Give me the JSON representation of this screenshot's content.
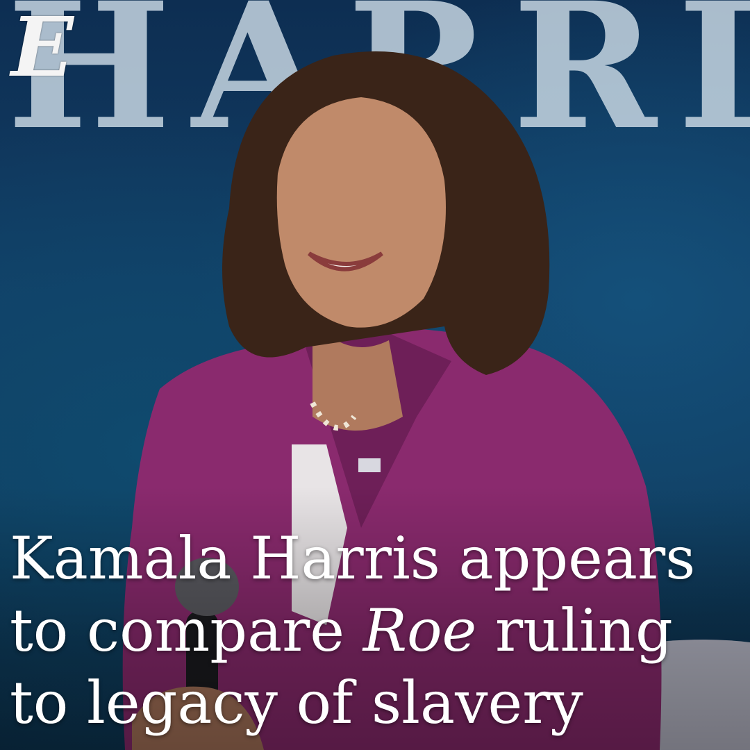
{
  "backdrop": {
    "text": "HARRI"
  },
  "logo": {
    "glyph": "E"
  },
  "headline": {
    "line1": "Kamala Harris appears",
    "line2_before": "to compare ",
    "line2_italic": "Roe",
    "line2_after": " ruling",
    "line3": "to legacy of slavery"
  },
  "colors": {
    "suit": "#8a2a6e",
    "background": "#123e66",
    "headline_text": "#ffffff"
  }
}
